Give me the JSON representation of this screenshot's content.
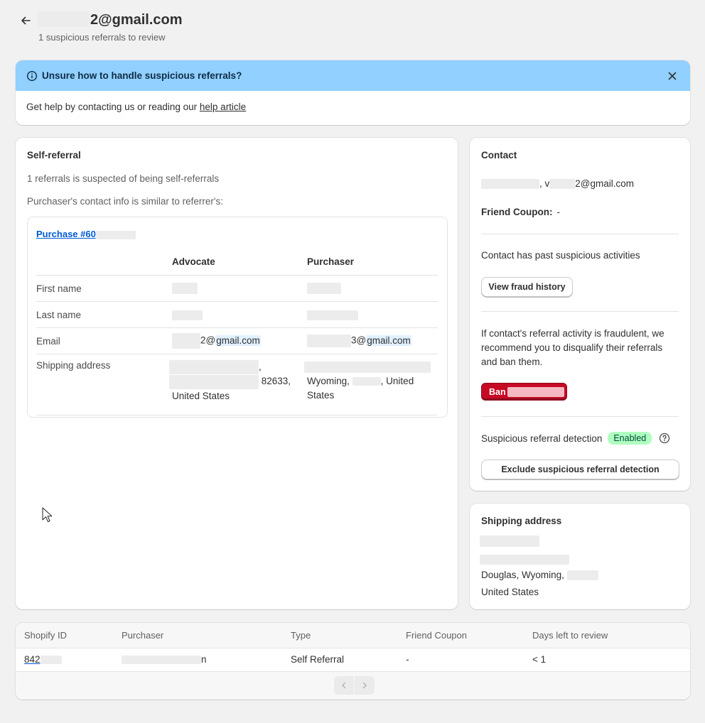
{
  "header": {
    "title_suffix": "2@gmail.com",
    "subtitle": "1 suspicious referrals to review"
  },
  "banner": {
    "title": "Unsure how to handle suspicious referrals?",
    "body_prefix": "Get help by contacting us or reading our ",
    "link": "help article"
  },
  "self_referral": {
    "title": "Self-referral",
    "line1": "1 referrals is suspected of being self-referrals",
    "line2": "Purchaser's contact info is similar to referrer's:",
    "purchase_link": "Purchase #60",
    "columns": [
      "Advocate",
      "Purchaser"
    ],
    "rows": {
      "first_name": "First name",
      "last_name": "Last name",
      "email": "Email",
      "shipping": "Shipping address"
    },
    "advocate_email_suffix": "2@",
    "purchaser_email_suffix": "3@",
    "email_domain": "gmail.com",
    "advocate_address_line1": ",",
    "advocate_address_line2": "82633,",
    "advocate_address_line3": "United States",
    "purchaser_address_line1": "Wyoming,",
    "purchaser_address_line1b": ", United",
    "purchaser_address_line2": "States"
  },
  "contact": {
    "title": "Contact",
    "email_visible": "2@gmail.com",
    "email_sep": ", v",
    "coupon_label": "Friend Coupon:",
    "coupon_value": "-",
    "past_text": "Contact has past suspicious activities",
    "view_fraud": "View fraud history",
    "recommendation": "If contact's referral activity is fraudulent, we recommend you to disqualify their referrals and ban them.",
    "ban_label": "Ban",
    "detection_label": "Suspicious referral detection",
    "detection_status": "Enabled",
    "exclude_label": "Exclude suspicious referral detection"
  },
  "shipping": {
    "title": "Shipping address",
    "city_line": "Douglas, Wyoming,",
    "country": "United States"
  },
  "list": {
    "headers": [
      "Shopify ID",
      "Purchaser",
      "Type",
      "Friend Coupon",
      "Days left to review"
    ],
    "row": {
      "shopify_id": "842",
      "purchaser_end": "n",
      "type": "Self Referral",
      "coupon": "-",
      "days_left": "< 1"
    }
  },
  "colors": {
    "banner_bg": "#91d0ff",
    "ban_button": "#c70a24",
    "enabled_badge": "#affebf",
    "link": "#005bd3"
  },
  "icons": [
    "arrow-left-icon",
    "info-icon",
    "close-icon",
    "help-circle-icon",
    "chevron-left-icon",
    "chevron-right-icon",
    "mouse-cursor-icon"
  ]
}
